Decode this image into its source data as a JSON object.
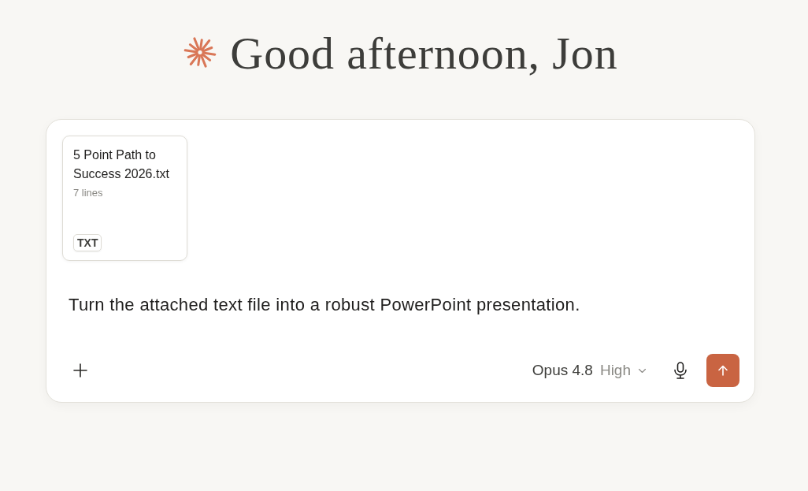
{
  "greeting": {
    "text": "Good afternoon, Jon"
  },
  "composer": {
    "attachments": [
      {
        "name": "5 Point Path to Success 2026.txt",
        "meta": "7 lines",
        "type": "TXT"
      }
    ],
    "message": "Turn the attached text file into a robust PowerPoint presentation.",
    "model": {
      "name": "Opus 4.8",
      "effort": "High"
    }
  }
}
